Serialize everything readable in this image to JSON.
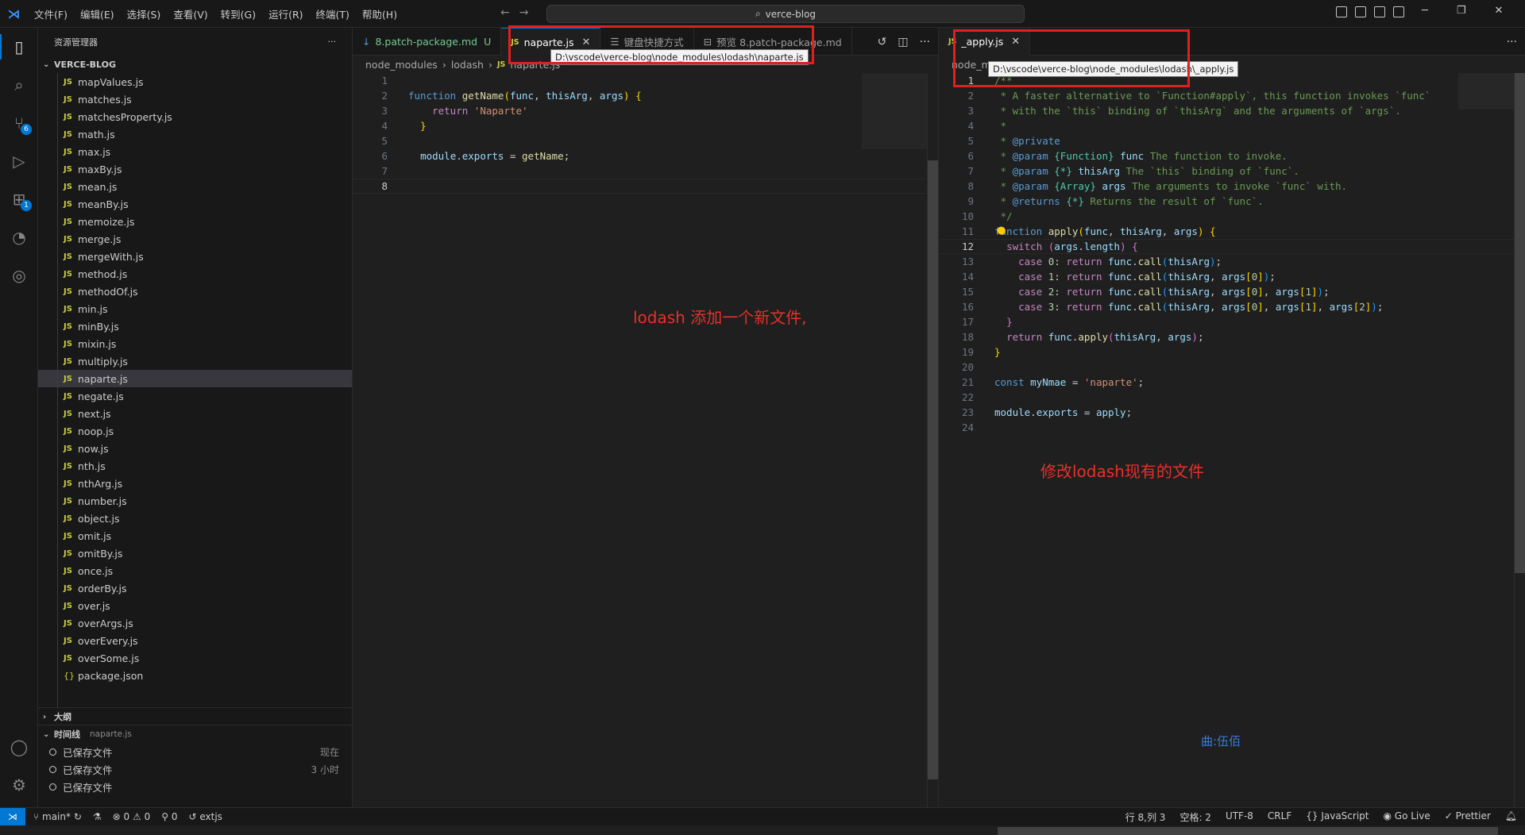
{
  "menu": [
    "文件(F)",
    "编辑(E)",
    "选择(S)",
    "查看(V)",
    "转到(G)",
    "运行(R)",
    "终端(T)",
    "帮助(H)"
  ],
  "search": {
    "label": "verce-blog"
  },
  "sidebar": {
    "title": "资源管理器",
    "project": "VERCE-BLOG",
    "files": [
      {
        "name": "mapValues.js",
        "type": "js"
      },
      {
        "name": "matches.js",
        "type": "js"
      },
      {
        "name": "matchesProperty.js",
        "type": "js"
      },
      {
        "name": "math.js",
        "type": "js"
      },
      {
        "name": "max.js",
        "type": "js"
      },
      {
        "name": "maxBy.js",
        "type": "js"
      },
      {
        "name": "mean.js",
        "type": "js"
      },
      {
        "name": "meanBy.js",
        "type": "js"
      },
      {
        "name": "memoize.js",
        "type": "js"
      },
      {
        "name": "merge.js",
        "type": "js"
      },
      {
        "name": "mergeWith.js",
        "type": "js"
      },
      {
        "name": "method.js",
        "type": "js"
      },
      {
        "name": "methodOf.js",
        "type": "js"
      },
      {
        "name": "min.js",
        "type": "js"
      },
      {
        "name": "minBy.js",
        "type": "js"
      },
      {
        "name": "mixin.js",
        "type": "js"
      },
      {
        "name": "multiply.js",
        "type": "js"
      },
      {
        "name": "naparte.js",
        "type": "js",
        "selected": true
      },
      {
        "name": "negate.js",
        "type": "js"
      },
      {
        "name": "next.js",
        "type": "js"
      },
      {
        "name": "noop.js",
        "type": "js"
      },
      {
        "name": "now.js",
        "type": "js"
      },
      {
        "name": "nth.js",
        "type": "js"
      },
      {
        "name": "nthArg.js",
        "type": "js"
      },
      {
        "name": "number.js",
        "type": "js"
      },
      {
        "name": "object.js",
        "type": "js"
      },
      {
        "name": "omit.js",
        "type": "js"
      },
      {
        "name": "omitBy.js",
        "type": "js"
      },
      {
        "name": "once.js",
        "type": "js"
      },
      {
        "name": "orderBy.js",
        "type": "js"
      },
      {
        "name": "over.js",
        "type": "js"
      },
      {
        "name": "overArgs.js",
        "type": "js"
      },
      {
        "name": "overEvery.js",
        "type": "js"
      },
      {
        "name": "overSome.js",
        "type": "js"
      },
      {
        "name": "package.json",
        "type": "json"
      }
    ],
    "outline_label": "大纲",
    "timeline_label": "时间线",
    "timeline_file": "naparte.js",
    "timeline": [
      {
        "label": "已保存文件",
        "time": "现在"
      },
      {
        "label": "已保存文件",
        "time": "3 小时"
      },
      {
        "label": "已保存文件",
        "time": ""
      }
    ]
  },
  "activity_badges": {
    "scm": "6",
    "extensions": "1"
  },
  "group1": {
    "tabs": [
      {
        "label": "8.patch-package.md",
        "suffix": "U"
      },
      {
        "label": "naparte.js"
      },
      {
        "label": "键盘快捷方式"
      },
      {
        "label": "预览 8.patch-package.md"
      }
    ],
    "breadcrumb": [
      "node_modules",
      "lodash",
      "naparte.js"
    ],
    "tooltip": "D:\\vscode\\verce-blog\\node_modules\\lodash\\naparte.js",
    "annotation": "lodash 添加一个新文件,"
  },
  "group2": {
    "tab": "_apply.js",
    "breadcrumb_start": "node_m",
    "tooltip": "D:\\vscode\\verce-blog\\node_modules\\lodash\\_apply.js",
    "annotation": "修改lodash现有的文件",
    "watermark": "曲:伍佰"
  },
  "statusbar": {
    "branch": "main*",
    "errors": "0",
    "warnings": "0",
    "ports": "0",
    "ext": "extjs",
    "cursor": "行 8,列 3",
    "spaces": "空格: 2",
    "encoding": "UTF-8",
    "eol": "CRLF",
    "language": "JavaScript",
    "golive": "Go Live",
    "prettier": "Prettier"
  }
}
